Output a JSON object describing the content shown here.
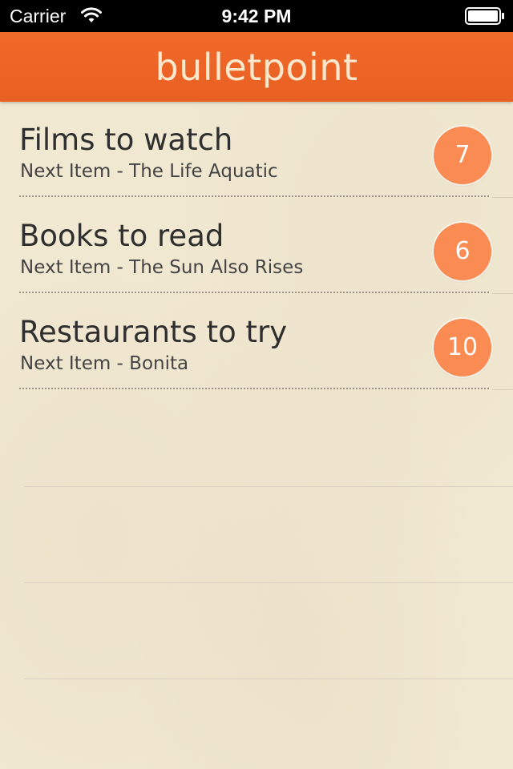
{
  "status_bar": {
    "carrier": "Carrier",
    "time": "9:42 PM",
    "wifi_icon": "wifi-icon",
    "battery_icon": "battery-icon"
  },
  "header": {
    "title": "bulletpoint",
    "color": "#ee6627"
  },
  "lists": [
    {
      "title": "Films to watch",
      "subtitle": "Next Item - The Life Aquatic",
      "count": "7"
    },
    {
      "title": "Books to read",
      "subtitle": "Next Item - The Sun Also Rises",
      "count": "6"
    },
    {
      "title": "Restaurants to try",
      "subtitle": "Next Item - Bonita",
      "count": "10"
    }
  ],
  "colors": {
    "background": "#f1e8d2",
    "badge": "#f98b53",
    "text": "#2f2f2f"
  }
}
